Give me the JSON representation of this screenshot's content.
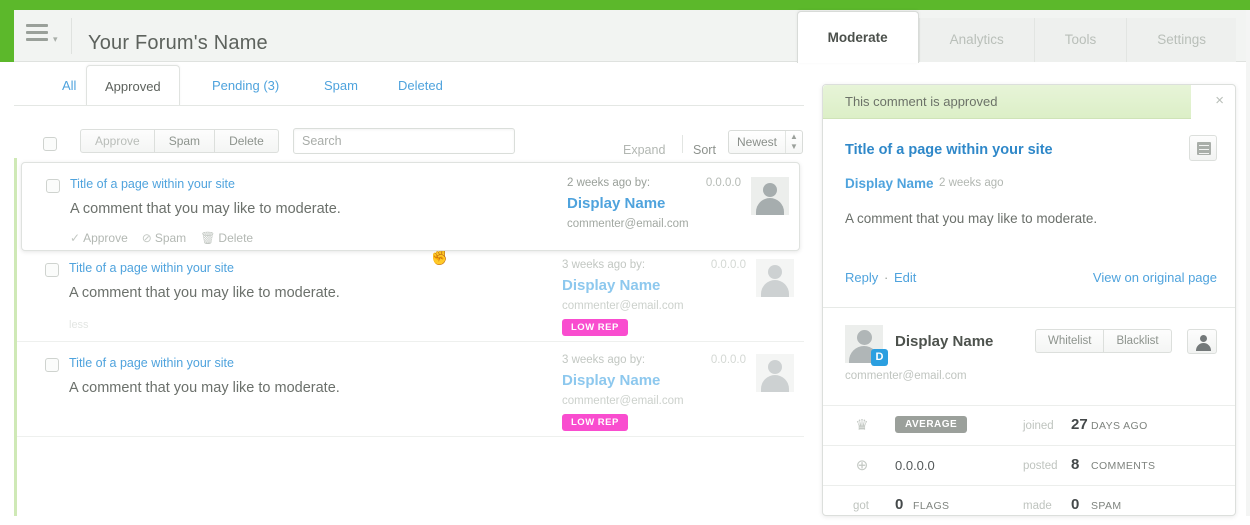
{
  "brand": {
    "color": "#5cb82b",
    "accent_blue": "#4fa3dd",
    "lowrep_pink": "#f93ecb"
  },
  "header": {
    "menu_icon": "hamburger-icon",
    "caret": "▾",
    "forum_title": "Your Forum's Name"
  },
  "topnav": [
    {
      "label": "Moderate",
      "active": true
    },
    {
      "label": "Analytics",
      "active": false
    },
    {
      "label": "Tools",
      "active": false
    },
    {
      "label": "Settings",
      "active": false
    }
  ],
  "subtabs": [
    {
      "label": "All"
    },
    {
      "label": "Approved"
    },
    {
      "label": "Pending (3)"
    },
    {
      "label": "Spam"
    },
    {
      "label": "Deleted"
    }
  ],
  "toolbar": {
    "approve_label": "Approve",
    "spam_label": "Spam",
    "delete_label": "Delete",
    "search_placeholder": "Search",
    "search_value": "",
    "expand_label": "Expand",
    "sort_label": "Sort",
    "sort_value": "Newest",
    "sort_arrows": "▲▼"
  },
  "comments": [
    {
      "title": "Title of a page within your site",
      "body": "A comment that you may like to moderate.",
      "time": "2 weeks ago by:",
      "name": "Display Name",
      "email": "commenter@email.com",
      "ip": "0.0.0.0",
      "actions": {
        "approve": "Approve",
        "spam": "Spam",
        "delete": "Delete",
        "approve_icon": "check-icon",
        "spam_icon": "ban-icon",
        "delete_icon": "trash-icon"
      }
    },
    {
      "title": "Title of a page within your site",
      "body": "A comment that you may like to moderate.",
      "less_label": "less",
      "time": "3 weeks ago by:",
      "name": "Display Name",
      "email": "commenter@email.com",
      "ip": "0.0.0.0",
      "badge": "LOW REP"
    },
    {
      "title": "Title of a page within your site",
      "body": "A comment that you may like to moderate.",
      "time": "3 weeks ago by:",
      "name": "Display Name",
      "email": "commenter@email.com",
      "ip": "0.0.0.0",
      "badge": "LOW REP"
    }
  ],
  "panel": {
    "banner": "This comment is approved",
    "close_icon": "×",
    "title": "Title of a page within your site",
    "doc_icon": "article-icon",
    "author": "Display Name",
    "date": "2 weeks ago",
    "text": "A comment that you may like to moderate.",
    "reply_label": "Reply",
    "separator": "·",
    "edit_label": "Edit",
    "view_label": "View on original page",
    "user": {
      "name": "Display Name",
      "email": "commenter@email.com",
      "badge_letter": "D",
      "whitelist_label": "Whitelist",
      "blacklist_label": "Blacklist",
      "person_icon": "person-icon"
    },
    "stats": [
      {
        "icon": "trophy-icon",
        "pill": "AVERAGE",
        "mid_label": "joined",
        "number": "27",
        "unit": "DAYS AGO"
      },
      {
        "icon": "globe-icon",
        "value": "0.0.0.0",
        "mid_label": "posted",
        "number": "8",
        "unit": "COMMENTS"
      },
      {
        "left_label": "got",
        "number_left": "0",
        "unit_left": "FLAGS",
        "mid_label": "made",
        "number": "0",
        "unit": "SPAM"
      }
    ]
  }
}
